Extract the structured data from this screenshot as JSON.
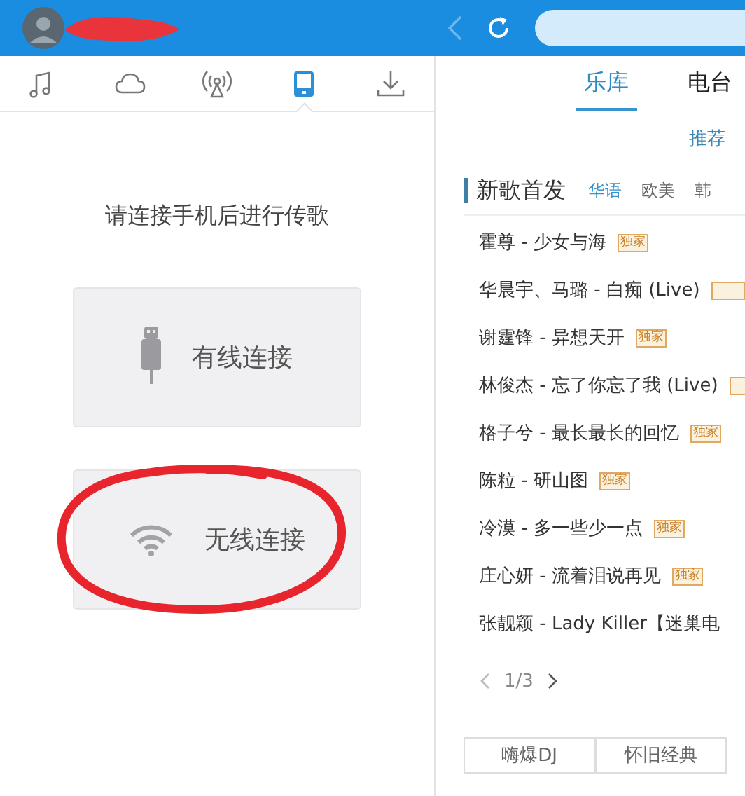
{
  "header": {
    "name_redacted": true
  },
  "nav_icons": [
    {
      "kind": "music",
      "selected": false
    },
    {
      "kind": "cloud",
      "selected": false
    },
    {
      "kind": "radio",
      "selected": false
    },
    {
      "kind": "phone",
      "selected": true
    },
    {
      "kind": "download",
      "selected": false
    }
  ],
  "phone_panel": {
    "prompt": "请连接手机后进行传歌",
    "options": [
      {
        "kind": "usb",
        "label": "有线连接",
        "circled": false
      },
      {
        "kind": "wifi",
        "label": "无线连接",
        "circled": true
      }
    ]
  },
  "library_tabs": [
    {
      "label": "乐库",
      "selected": true
    },
    {
      "label": "电台",
      "selected": false
    }
  ],
  "subtabs": [
    {
      "label": "推荐",
      "selected": true
    }
  ],
  "section": {
    "title": "新歌首发",
    "filters": [
      {
        "label": "华语",
        "selected": true
      },
      {
        "label": "欧美",
        "selected": false
      },
      {
        "label": "韩",
        "selected": false
      }
    ],
    "songs": [
      {
        "title": "霍尊 - 少女与海",
        "tag": "独家"
      },
      {
        "title": "华晨宇、马璐 - 白痴 (Live)",
        "tag_cut": true
      },
      {
        "title": "谢霆锋 - 异想天开",
        "tag": "独家"
      },
      {
        "title": "林俊杰 - 忘了你忘了我 (Live)",
        "tag_cut": true
      },
      {
        "title": "格子兮 - 最长最长的回忆",
        "tag": "独家"
      },
      {
        "title": "陈粒 - 研山图",
        "tag": "独家"
      },
      {
        "title": "冷漠 - 多一些少一点",
        "tag": "独家"
      },
      {
        "title": "庄心妍 - 流着泪说再见",
        "tag": "独家"
      },
      {
        "title": "张靓颖 - Lady Killer【迷巢电"
      }
    ],
    "page": "1/3",
    "categories": [
      "嗨爆DJ",
      "怀旧经典"
    ]
  }
}
